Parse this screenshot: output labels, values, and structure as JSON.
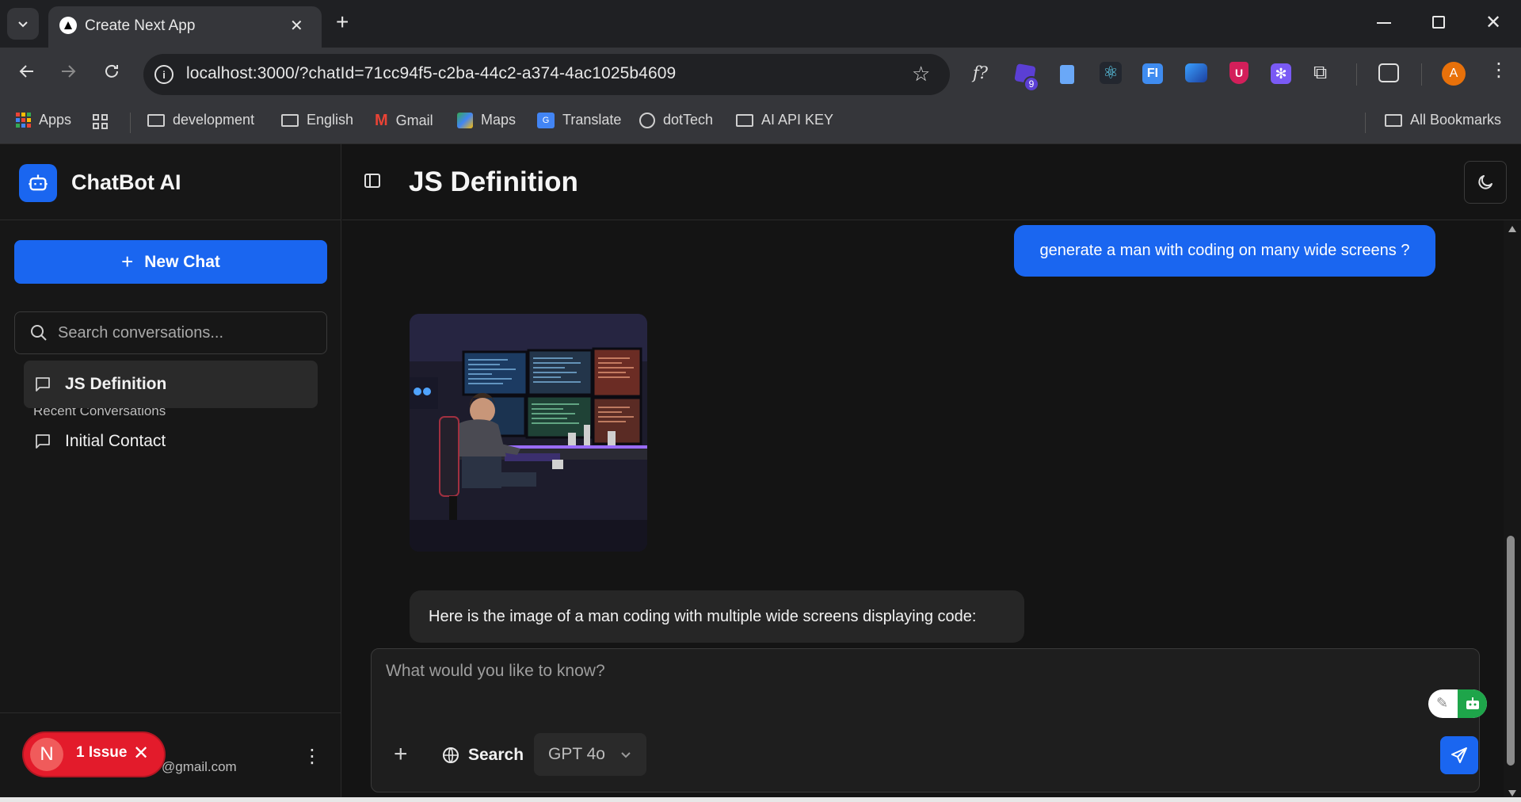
{
  "browser": {
    "tab_title": "Create Next App",
    "url": "localhost:3000/?chatId=71cc94f5-c2ba-44c2-a374-4ac1025b4609",
    "extension_badge": "9",
    "profile_initial": "A",
    "bookmarks": [
      {
        "label": "Apps",
        "icon": "apps-grid-icon"
      },
      {
        "label": "development",
        "icon": "folder-icon"
      },
      {
        "label": "English",
        "icon": "folder-icon"
      },
      {
        "label": "Gmail",
        "icon": "gmail-icon"
      },
      {
        "label": "Maps",
        "icon": "maps-icon"
      },
      {
        "label": "Translate",
        "icon": "translate-icon"
      },
      {
        "label": "dotTech",
        "icon": "globe-icon"
      },
      {
        "label": "AI API KEY",
        "icon": "folder-icon"
      }
    ],
    "all_bookmarks": "All Bookmarks"
  },
  "sidebar": {
    "app_title": "ChatBot AI",
    "new_chat_label": "New Chat",
    "search_placeholder": "Search conversations...",
    "recent_label": "Recent Conversations",
    "conversations": [
      {
        "title": "JS Definition",
        "active": true
      },
      {
        "title": "Initial Contact",
        "active": false
      }
    ],
    "email_suffix": "@gmail.com",
    "issue": {
      "initial": "N",
      "label": "1 Issue"
    }
  },
  "main": {
    "chat_title": "JS Definition",
    "messages": [
      {
        "role": "user",
        "text": "generate a man with coding on many wide screens ?"
      },
      {
        "role": "assistant",
        "type": "image"
      },
      {
        "role": "assistant",
        "text": "Here is the image of a man coding with multiple wide screens displaying code:"
      }
    ],
    "composer": {
      "placeholder": "What would you like to know?",
      "search_label": "Search",
      "model": "GPT 4o"
    }
  },
  "colors": {
    "accent": "#1a66f0",
    "issue_red": "#e31b2b",
    "background": "#141414"
  }
}
